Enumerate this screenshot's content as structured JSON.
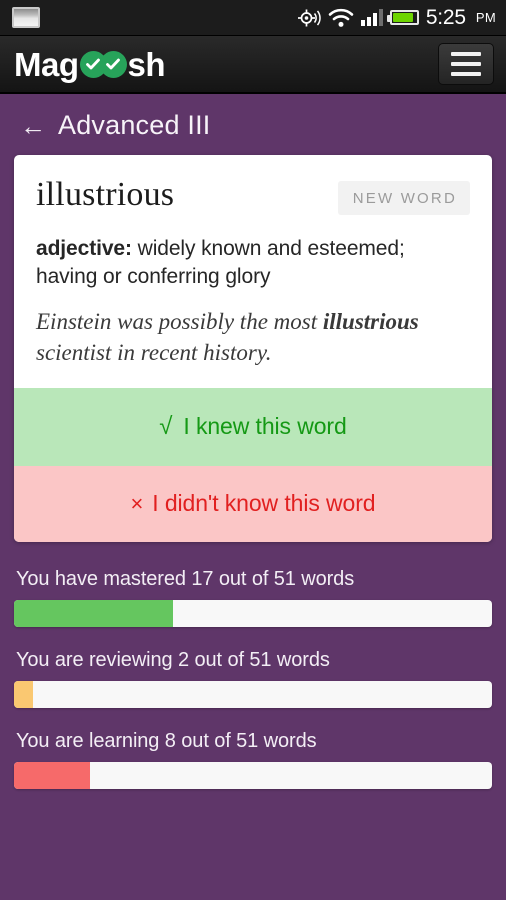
{
  "status_bar": {
    "notification_icon": "screenshot-icon",
    "icons": [
      "gps-icon",
      "wifi-icon",
      "signal-icon",
      "battery-icon"
    ],
    "time": "5:25",
    "am_pm": "PM"
  },
  "app_bar": {
    "logo_part1": "Mag",
    "logo_part2": "sh",
    "logo_check": "✔",
    "menu_label": "menu"
  },
  "header": {
    "back_arrow": "←",
    "title": "Advanced III"
  },
  "card": {
    "word": "illustrious",
    "badge": "NEW WORD",
    "part_of_speech": "adjective:",
    "definition": " widely known and esteemed; having or conferring glory",
    "example_prefix": "Einstein was possibly the most ",
    "example_word": "illustrious",
    "example_suffix": " scientist in recent history.",
    "knew_mark": "√",
    "knew_label": "I knew this word",
    "didnt_mark": "×",
    "didnt_label": "I didn't know this word"
  },
  "progress": {
    "items": [
      {
        "label": "You have mastered 17 out of 51 words",
        "value": 17,
        "total": 51,
        "percent": 33.3,
        "color": "#65c65f"
      },
      {
        "label": "You are reviewing 2 out of 51 words",
        "value": 2,
        "total": 51,
        "percent": 4.0,
        "color": "#fac871"
      },
      {
        "label": "You are learning 8 out of 51 words",
        "value": 8,
        "total": 51,
        "percent": 16.0,
        "color": "#f66a6a"
      }
    ]
  },
  "theme": {
    "background": "#5f3669",
    "accent_green": "#159915",
    "accent_red": "#e12020"
  }
}
